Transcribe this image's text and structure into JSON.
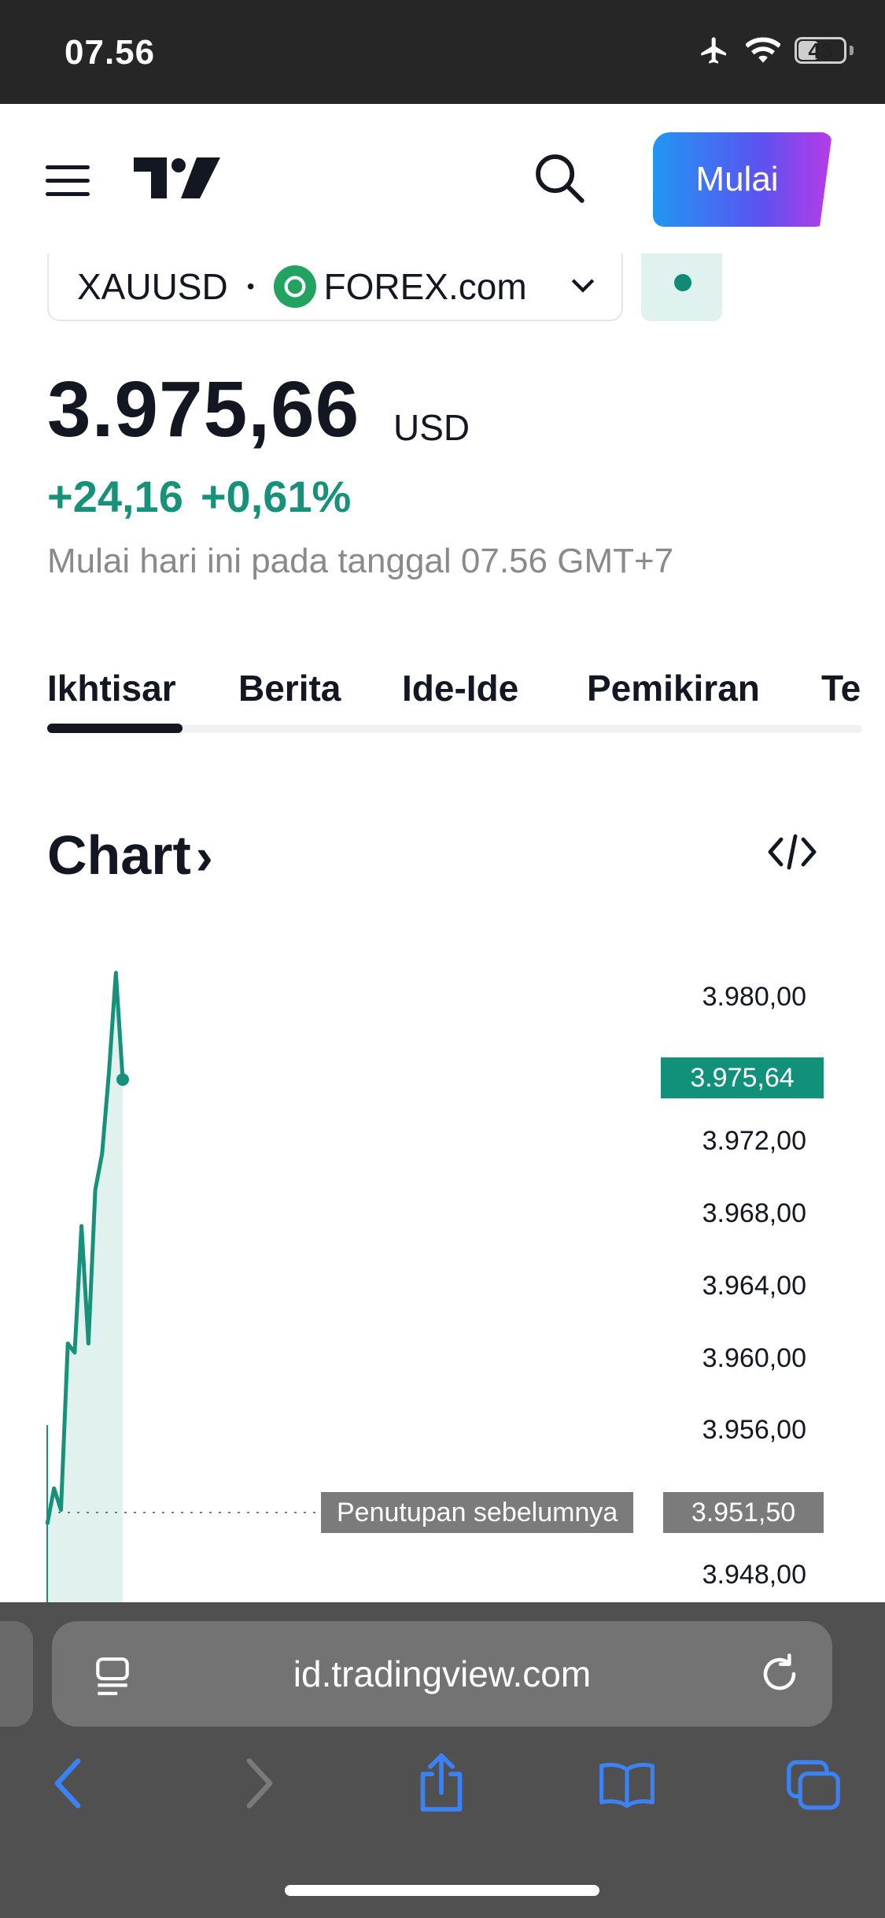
{
  "status_bar": {
    "time": "07.56",
    "battery": "43",
    "battery_level": 0.43
  },
  "nav": {
    "cta_label": "Mulai"
  },
  "symbol": {
    "ticker": "XAUUSD",
    "separator": "•",
    "exchange": "FOREX.com"
  },
  "quote": {
    "price": "3.975,66",
    "currency": "USD",
    "change_abs": "+24,16",
    "change_pct": "+0,61%",
    "session_note": "Mulai hari ini pada tanggal 07.56 GMT+7"
  },
  "tabs": [
    "Ikhtisar",
    "Berita",
    "Ide-Ide",
    "Pemikiran",
    "Te"
  ],
  "chart": {
    "title": "Chart",
    "arrow": "›",
    "last_price_tag": "3.975,64",
    "prev_close_label": "Penutupan sebelumnya",
    "prev_close_value": "3.951,50",
    "y_ticks": [
      "3.980,00",
      "3.972,00",
      "3.968,00",
      "3.964,00",
      "3.960,00",
      "3.956,00",
      "3.948,00"
    ]
  },
  "chart_data": {
    "type": "area",
    "ylim": [
      3946,
      3982
    ],
    "points": [
      3951.0,
      3953.0,
      3951.8,
      3961.0,
      3960.5,
      3967.5,
      3961.0,
      3969.5,
      3971.5,
      3976.0,
      3981.5,
      3975.6
    ],
    "color": "#17917a",
    "prev_close": 3951.5
  },
  "browser": {
    "url": "id.tradingview.com"
  },
  "colors": {
    "accent_green": "#17917a",
    "status_bg": "#262626",
    "browser_bg": "#505050"
  }
}
